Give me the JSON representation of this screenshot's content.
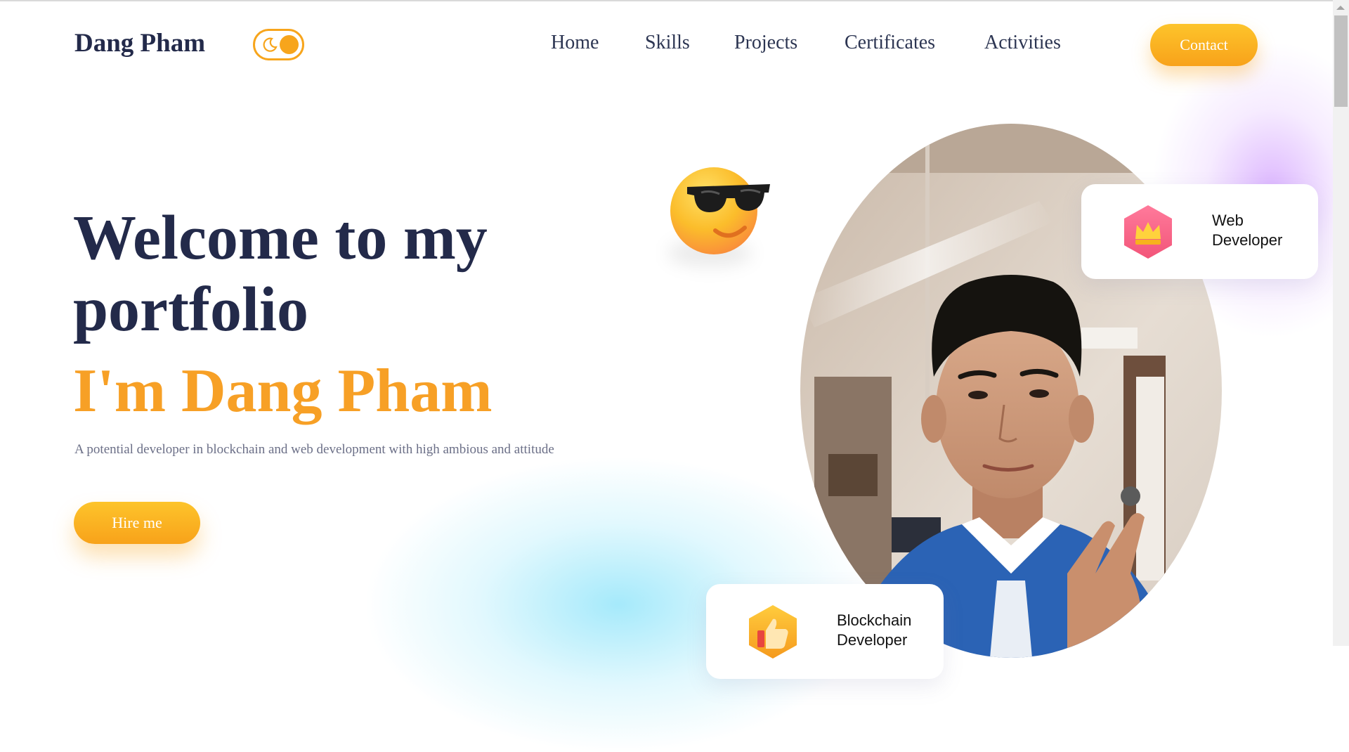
{
  "header": {
    "logo": "Dang Pham",
    "theme_toggle_icon": "moon-toggle-icon",
    "nav": [
      "Home",
      "Skills",
      "Projects",
      "Certificates",
      "Activities"
    ],
    "contact_label": "Contact"
  },
  "hero": {
    "title_line1": "Welcome to my",
    "title_line2": "portfolio",
    "name": "I'm Dang Pham",
    "subtitle": "A potential developer in blockchain and web development with high ambious and attitude",
    "hire_label": "Hire me",
    "emoji": "sunglasses-emoji-icon",
    "portrait": "profile-photo"
  },
  "cards": {
    "web": {
      "icon": "crown-icon",
      "label": "Web Developer"
    },
    "blockchain": {
      "icon": "thumbs-up-icon",
      "label": "Blockchain Developer"
    }
  },
  "colors": {
    "accent": "#f7a026",
    "heading": "#232a4a",
    "text_muted": "#6b6f87"
  }
}
